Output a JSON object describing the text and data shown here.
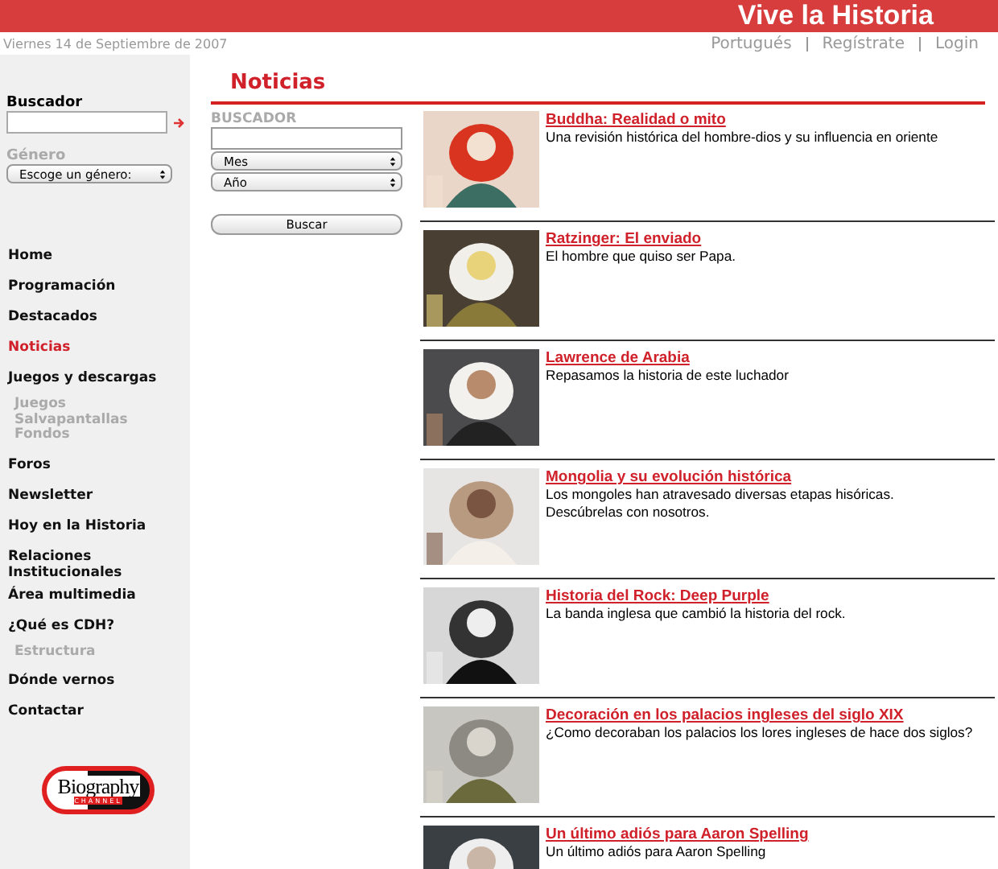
{
  "header": {
    "title": "Vive la Historia"
  },
  "date": "Viernes 14 de Septiembre de 2007",
  "top_links": [
    "Portugués",
    "Regístrate",
    "Login"
  ],
  "sidebar": {
    "search_label": "Buscador",
    "genre_label": "Género",
    "genre_select": "Escoge un género:",
    "items": [
      {
        "label": "Home",
        "selected": false
      },
      {
        "label": "Programación",
        "selected": false
      },
      {
        "label": "Destacados",
        "selected": false
      },
      {
        "label": "Noticias",
        "selected": true
      },
      {
        "label": "Juegos y descargas",
        "selected": false,
        "children": [
          {
            "label": "Juegos"
          },
          {
            "label": "Salvapantallas"
          },
          {
            "label": "Fondos"
          }
        ]
      },
      {
        "label": "Foros",
        "selected": false
      },
      {
        "label": "Newsletter",
        "selected": false
      },
      {
        "label": "Hoy en la Historia",
        "selected": false
      },
      {
        "label": "Relaciones Institucionales",
        "selected": false
      },
      {
        "label": "Área multimedia",
        "selected": false
      },
      {
        "label": "¿Qué es CDH?",
        "selected": false,
        "children": [
          {
            "label": "Estructura"
          }
        ]
      },
      {
        "label": "Dónde vernos",
        "selected": false
      },
      {
        "label": "Contactar",
        "selected": false
      }
    ],
    "logo": {
      "main": "Biography",
      "sub": "CHANNEL"
    }
  },
  "page_title": "Noticias",
  "filter": {
    "label": "BUSCADOR",
    "month": "Mes",
    "year": "Año",
    "button": "Buscar"
  },
  "articles": [
    {
      "title": "Buddha: Realidad o mito",
      "summary": "Una revisión histórica del hombre-dios y su influencia en oriente",
      "kind": "picture"
    },
    {
      "title": "Ratzinger: El enviado",
      "summary": "El hombre que quiso ser Papa.",
      "kind": "picture"
    },
    {
      "title": "Lawrence de Arabia",
      "summary": "Repasamos la historia de este luchador",
      "kind": "picture"
    },
    {
      "title": "Mongolia y su evolución histórica",
      "summary": "Los mongoles han atravesado diversas etapas hisóricas.\nDescúbrelas con nosotros.",
      "kind": "picture"
    },
    {
      "title": "Historia del Rock: Deep Purple",
      "summary": "La banda inglesa que cambió la historia del rock.",
      "kind": "picture"
    },
    {
      "title": "Decoración en los palacios ingleses del siglo XIX",
      "summary": "¿Como decoraban los palacios los lores ingleses de hace dos siglos?",
      "kind": "picture"
    },
    {
      "title": "Un último adiós para Aaron Spelling",
      "summary": "Un último adiós para Aaron Spelling",
      "kind": "picture"
    }
  ]
}
